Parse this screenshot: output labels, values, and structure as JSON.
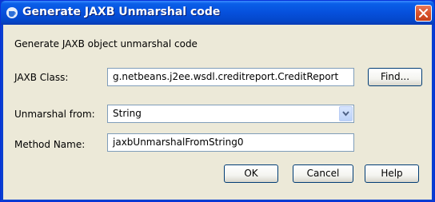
{
  "window": {
    "title": "Generate JAXB Unmarshal code",
    "icons": {
      "app": "coffee-cup-icon",
      "close": "close-x-icon"
    }
  },
  "dialog": {
    "heading": "Generate JAXB object unmarshal code",
    "jaxb_class": {
      "label": "JAXB Class:",
      "value": "g.netbeans.j2ee.wsdl.creditreport.CreditReport",
      "find_label": "Find..."
    },
    "unmarshal_from": {
      "label": "Unmarshal from:",
      "selected": "String"
    },
    "method_name": {
      "label": "Method Name:",
      "value": "jaxbUnmarshalFromString0"
    }
  },
  "buttons": {
    "ok": "OK",
    "cancel": "Cancel",
    "help": "Help"
  },
  "colors": {
    "titlebar": "#0650dc",
    "client": "#ece9d8",
    "close": "#d9532c",
    "field_border": "#7f9db9"
  }
}
